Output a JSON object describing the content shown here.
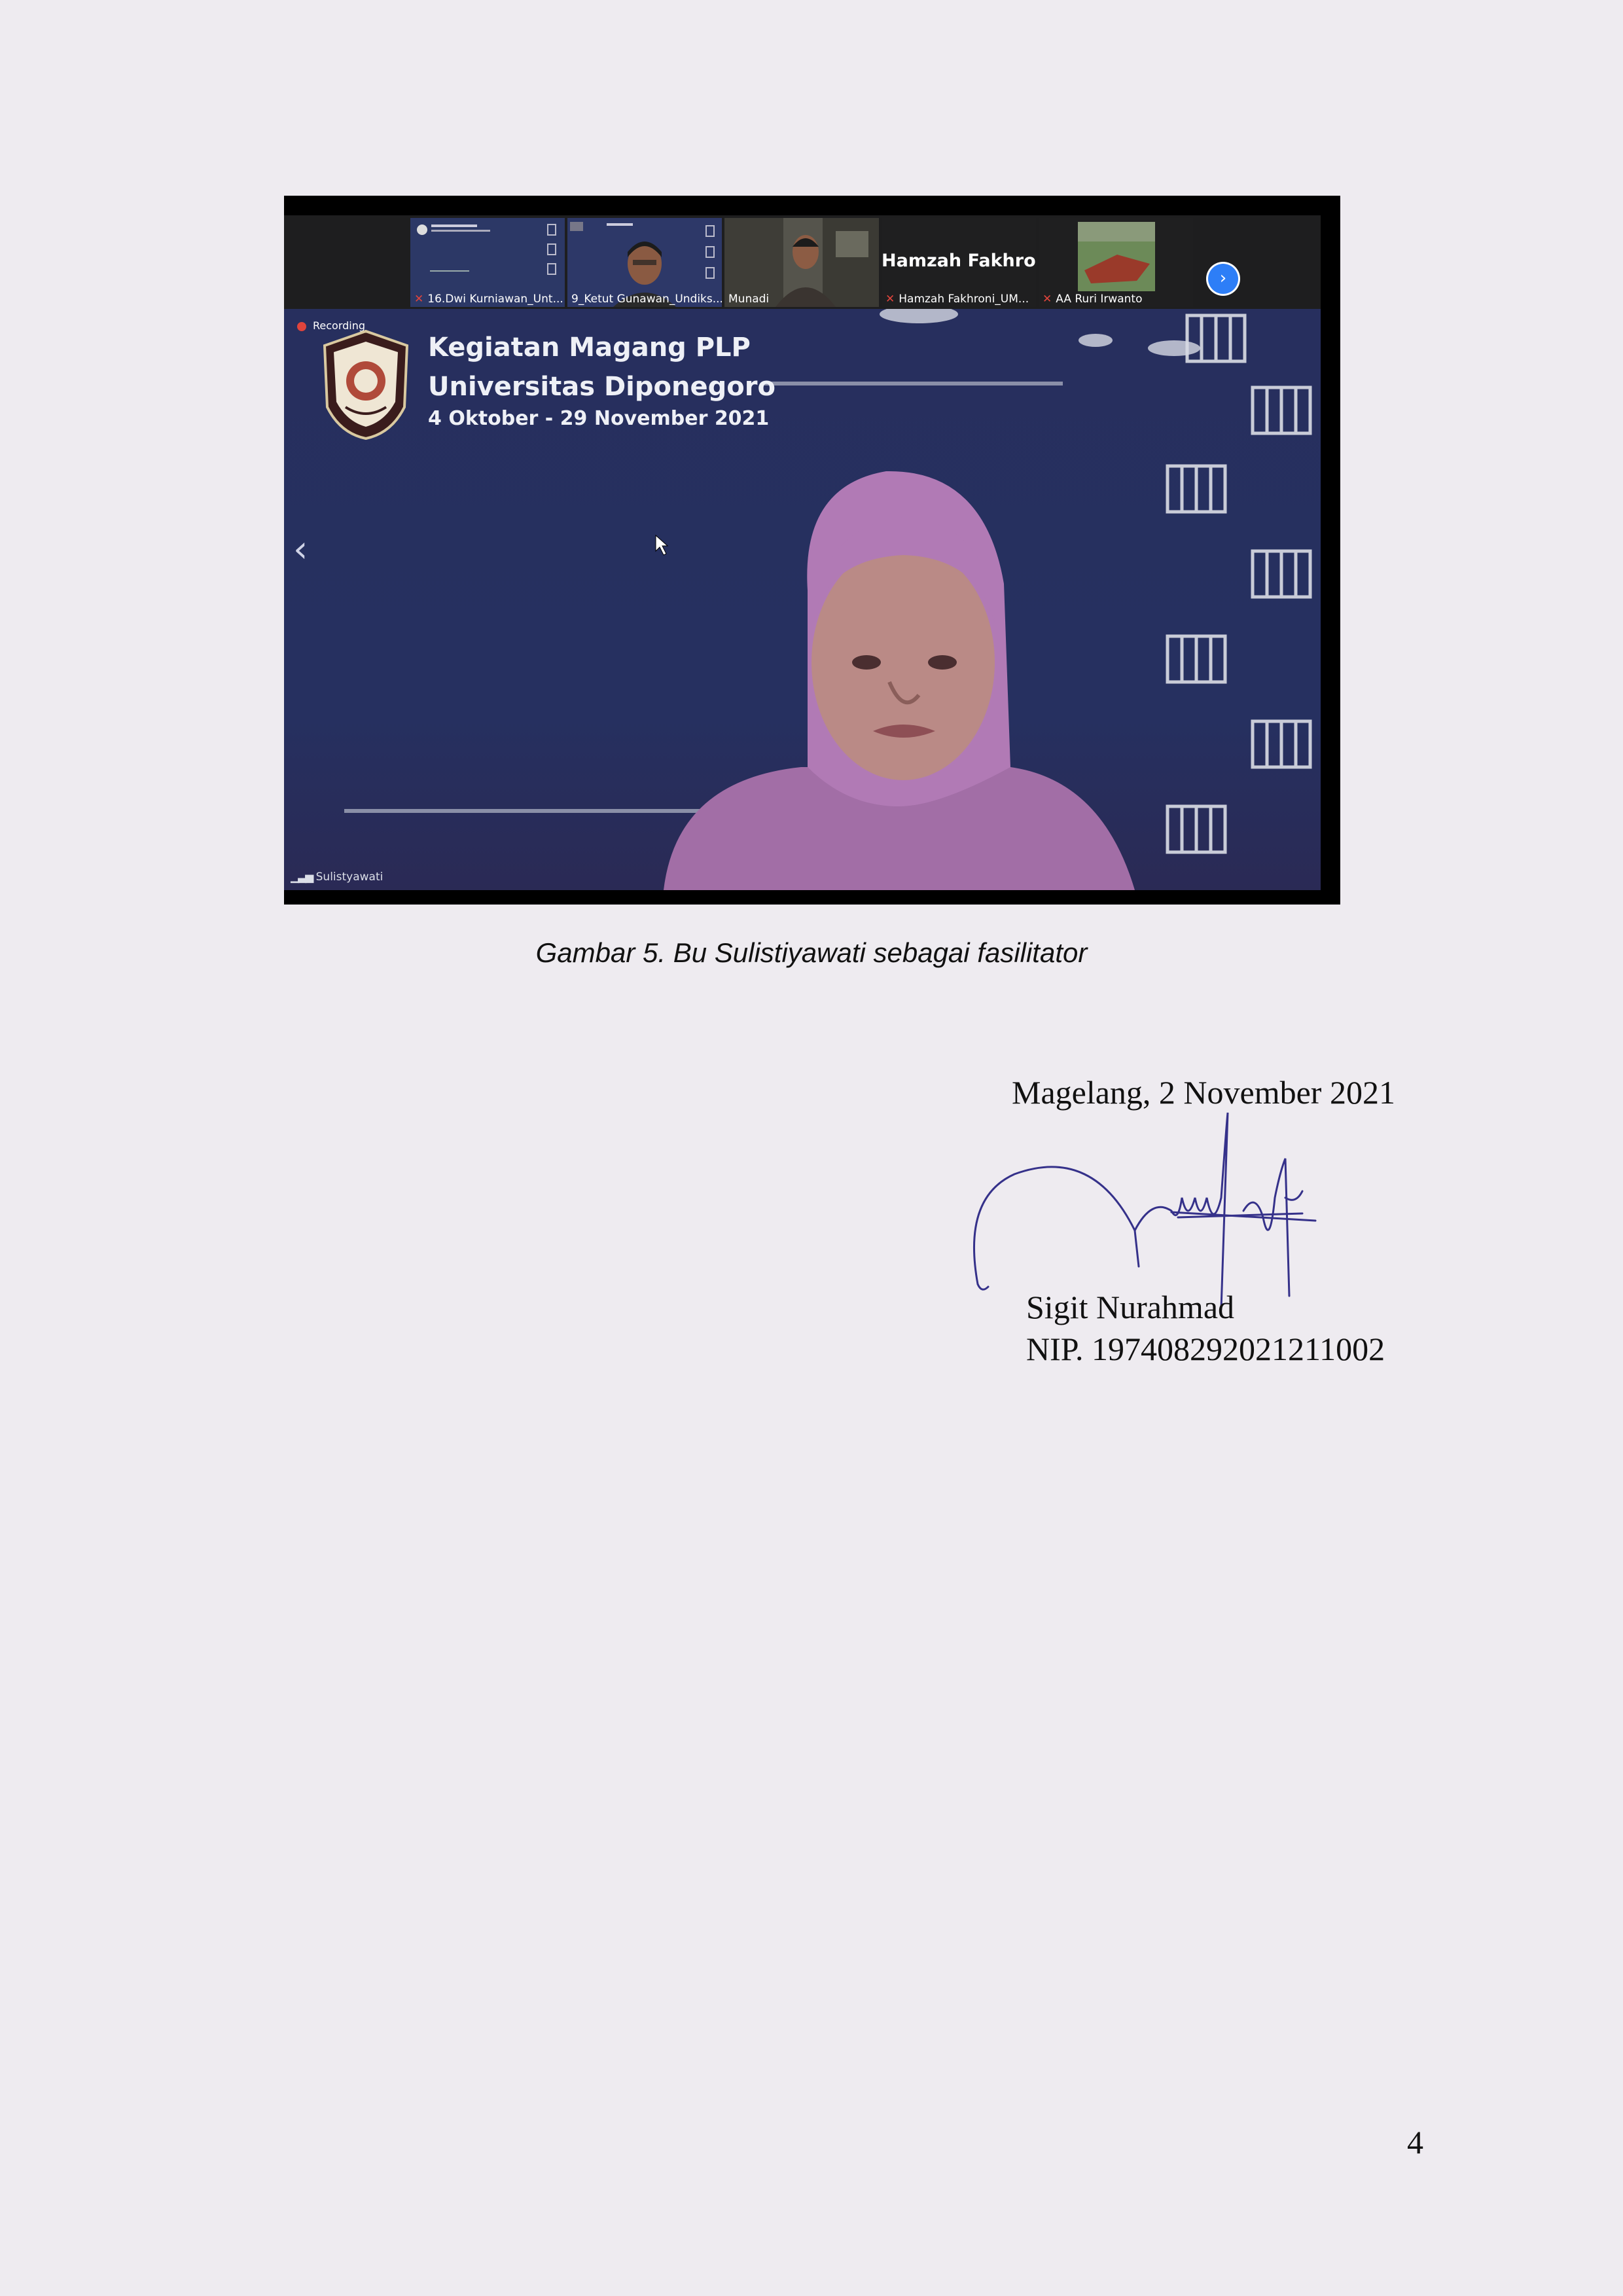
{
  "meeting": {
    "participants": [
      {
        "name": "16.Dwi Kurniawan_Unt...",
        "muted": true
      },
      {
        "name": "9_Ketut Gunawan_Undiks...",
        "muted": false
      },
      {
        "name": "Munadi",
        "muted": false
      },
      {
        "name": "Hamzah Fakhroni_UM...",
        "muted": true,
        "display": "Hamzah  Fakhro..."
      },
      {
        "name": "AA Ruri Irwanto",
        "muted": true
      }
    ],
    "recording_label": "Recording",
    "slide": {
      "line1": "Kegiatan Magang PLP",
      "line2": "Universitas Diponegoro",
      "line3": "4 Oktober - 29 November 2021"
    },
    "active_speaker": "Sulistyawati",
    "colors": {
      "stage": "#272f5e",
      "headscarf": "#b17ab5",
      "accent_button": "#2d7ef7",
      "recording": "#e0443c"
    }
  },
  "caption": "Gambar 5. Bu Sulistiyawati sebagai fasilitator",
  "signature_block": {
    "place_date": "Magelang, 2 November 2021",
    "name": "Sigit Nurahmad",
    "nip": "NIP. 197408292021211002"
  },
  "page_number": "4"
}
